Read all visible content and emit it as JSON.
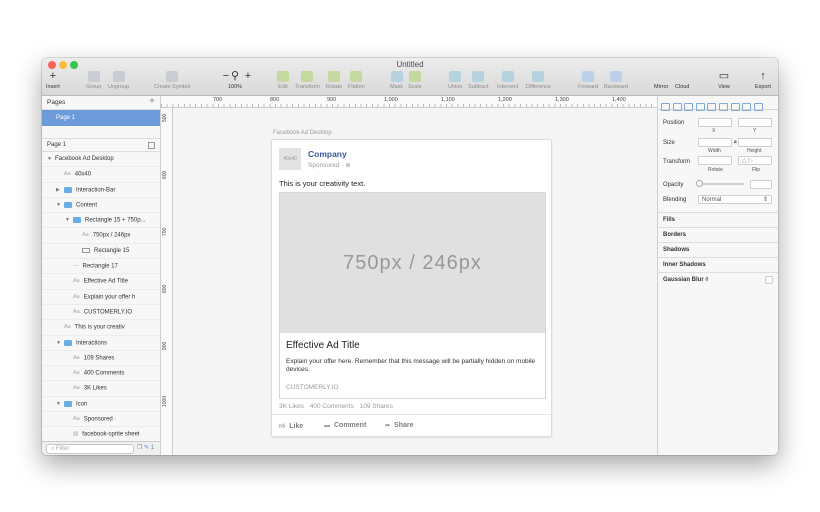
{
  "window": {
    "title": "Untitled"
  },
  "toolbar": {
    "insert": "Insert",
    "group": "Group",
    "ungroup": "Ungroup",
    "create_symbol": "Create Symbol",
    "zoom_minus": "−",
    "zoom_plus": "+",
    "zoom": "100%",
    "edit": "Edit",
    "transform": "Transform",
    "rotate": "Rotate",
    "flatten": "Flatten",
    "mask": "Mask",
    "scale": "Scale",
    "union": "Union",
    "subtract": "Subtract",
    "intersect": "Intersect",
    "difference": "Difference",
    "forward": "Forward",
    "backward": "Backward",
    "mirror": "Mirror",
    "cloud": "Cloud",
    "view": "View",
    "export": "Export"
  },
  "pages": {
    "header": "Pages",
    "selected": "Page 1",
    "current": "Page 1"
  },
  "layers": [
    {
      "label": "Facebook Ad Desktop",
      "indent": 0,
      "icon": "none",
      "arrow": "open"
    },
    {
      "label": "40x40",
      "indent": 1,
      "icon": "Aa",
      "arrow": ""
    },
    {
      "label": "Interaction-Bar",
      "indent": 1,
      "icon": "folder",
      "arrow": "closed"
    },
    {
      "label": "Content",
      "indent": 1,
      "icon": "folder",
      "arrow": "open"
    },
    {
      "label": "Rectangle 15 + 750p...",
      "indent": 2,
      "icon": "folder",
      "arrow": "open"
    },
    {
      "label": "750px / 246px",
      "indent": 3,
      "icon": "Aa",
      "arrow": ""
    },
    {
      "label": "Rectangle 15",
      "indent": 3,
      "icon": "rect",
      "arrow": ""
    },
    {
      "label": "Rectangle 17",
      "indent": 2,
      "icon": "line",
      "arrow": ""
    },
    {
      "label": "Effective Ad Title",
      "indent": 2,
      "icon": "Aa",
      "arrow": ""
    },
    {
      "label": "Explain your offer h",
      "indent": 2,
      "icon": "Aa",
      "arrow": ""
    },
    {
      "label": "CUSTOMERLY.IO",
      "indent": 2,
      "icon": "Aa",
      "arrow": ""
    },
    {
      "label": "This is your creativ",
      "indent": 1,
      "icon": "Aa",
      "arrow": ""
    },
    {
      "label": "Interactions",
      "indent": 1,
      "icon": "folder",
      "arrow": "open"
    },
    {
      "label": "109 Shares",
      "indent": 2,
      "icon": "Aa",
      "arrow": ""
    },
    {
      "label": "400 Comments",
      "indent": 2,
      "icon": "Aa",
      "arrow": ""
    },
    {
      "label": "3K Likes",
      "indent": 2,
      "icon": "Aa",
      "arrow": ""
    },
    {
      "label": "Icon",
      "indent": 1,
      "icon": "folder",
      "arrow": "open"
    },
    {
      "label": "Sponsored ·",
      "indent": 2,
      "icon": "Aa",
      "arrow": ""
    },
    {
      "label": "facebook-sprite sheet",
      "indent": 2,
      "icon": "img",
      "arrow": ""
    }
  ],
  "filter": {
    "placeholder": "Filter"
  },
  "rulers": {
    "top": [
      "700",
      "800",
      "900",
      "1,000",
      "1,100",
      "1,200",
      "1,300",
      "1,400"
    ],
    "left": [
      "500",
      "600",
      "700",
      "800",
      "900",
      "1000"
    ]
  },
  "artboard": {
    "name": "Facebook Ad Desktop"
  },
  "ad": {
    "avatar": "40x40",
    "company": "Company",
    "sponsored": "Sponsored · ⊕",
    "creativity": "This is your creativity text.",
    "image_label": "750px / 246px",
    "title": "Effective Ad Title",
    "description": "Explain your offer here. Remember that this message will be partially hidden on mobile devices.",
    "url": "CUSTOMERLY.IO",
    "likes": "3K Likes",
    "comments": "400 Comments",
    "shares": "109 Shares",
    "like_label": "Like",
    "comment_label": "Comment",
    "share_label": "Share"
  },
  "inspector": {
    "position": "Position",
    "x": "X",
    "y": "Y",
    "size": "Size",
    "width": "Width",
    "height": "Height",
    "transform": "Transform",
    "rotate": "Rotate",
    "flip": "Flip",
    "opacity": "Opacity",
    "blending": "Blending",
    "blending_value": "Normal",
    "fills": "Fills",
    "borders": "Borders",
    "shadows": "Shadows",
    "inner_shadows": "Inner Shadows",
    "gaussian_blur": "Gaussian Blur ◊"
  }
}
